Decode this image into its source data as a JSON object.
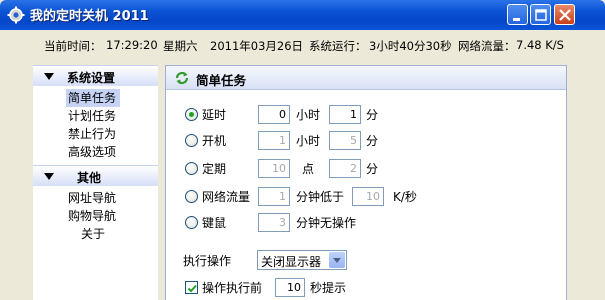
{
  "window": {
    "title": "我的定时关机 2011"
  },
  "status": {
    "current_time_label": "当前时间：",
    "current_time": "17:29:20",
    "weekday": "星期六",
    "date": "2011年03月26日",
    "uptime_label": "系统运行：",
    "uptime": "3小时40分30秒",
    "traffic_label": "网络流量：",
    "traffic": "7.48 K/S"
  },
  "sidebar": {
    "sections": [
      {
        "title": "系统设置",
        "items": [
          "简单任务",
          "计划任务",
          "禁止行为",
          "高级选项"
        ]
      },
      {
        "title": "其他",
        "items": [
          "网址导航",
          "购物导航",
          "关于"
        ]
      }
    ],
    "active_item": "简单任务"
  },
  "panel": {
    "title": "简单任务",
    "options": [
      {
        "label": "延时",
        "selected": true,
        "v1": "0",
        "u1": "小时",
        "v2": "1",
        "u2": "分"
      },
      {
        "label": "开机",
        "selected": false,
        "v1": "1",
        "u1": "小时",
        "v2": "5",
        "u2": "分"
      },
      {
        "label": "定期",
        "selected": false,
        "v1": "10",
        "u1": "点",
        "v2": "2",
        "u2": "分"
      },
      {
        "label": "网络流量",
        "selected": false,
        "v1": "1",
        "u1": "分钟低于",
        "v2": "10",
        "u2": "K/秒"
      },
      {
        "label": "键鼠",
        "selected": false,
        "v1": "3",
        "u1": "分钟无操作"
      }
    ],
    "exec_label": "执行操作",
    "exec_value": "关闭显示器",
    "notify_checked": true,
    "notify_label": "操作执行前",
    "notify_value": "10",
    "notify_unit": "秒提示"
  },
  "colors": {
    "titlebar": "#0546c8",
    "radio_selected": "#21a121",
    "active_item_bg": "#c6d3f5"
  }
}
